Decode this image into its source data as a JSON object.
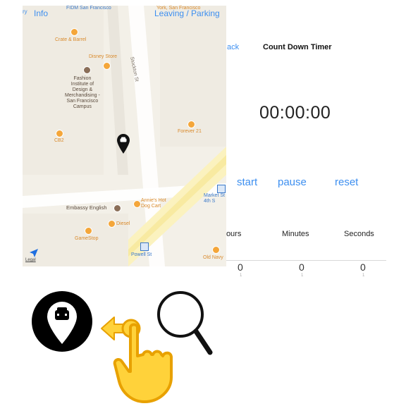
{
  "map": {
    "info": "Info",
    "left_edge": "ry",
    "leaving_parking": "Leaving / Parking",
    "legal": "Legal",
    "pois": {
      "fidm": "FIDM San\nFrancisco",
      "york": "York, San\nFrancisco",
      "crate": "Crate & Barrel",
      "disney": "Disney Store",
      "fashion": "Fashion\nInstitute of\nDesign &\nMerchandising -\nSan Francisco\nCampus",
      "cb2": "CB2",
      "forever": "Forever 21",
      "stockton": "Stockton St",
      "market": "Market St\n4th S",
      "annies": "Annie's Hot\nDog Cart",
      "embassy": "Embassy English",
      "diesel": "Diesel",
      "gamestop": "GameStop",
      "powell": "Powell St",
      "oldnavy": "Old Navy"
    }
  },
  "timer": {
    "back": "ack",
    "title": "Count Down Timer",
    "display": "00:00:00",
    "start": "start",
    "pause": "pause",
    "reset": "reset",
    "hours": "Hours",
    "minutes": "Minutes",
    "seconds": "Seconds",
    "hours_value": "0",
    "minutes_value": "0",
    "seconds_value": "0"
  }
}
